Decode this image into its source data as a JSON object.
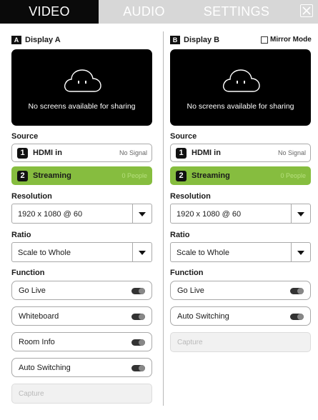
{
  "tabs": [
    {
      "label": "VIDEO",
      "active": true
    },
    {
      "label": "AUDIO",
      "active": false
    },
    {
      "label": "SETTINGS",
      "active": false
    }
  ],
  "close_icon": "close-x-icon",
  "display_a": {
    "letter": "A",
    "title": "Display A",
    "preview_message": "No screens available for sharing",
    "source_label": "Source",
    "sources": [
      {
        "num": "1",
        "name": "HDMI in",
        "status": "No Signal"
      },
      {
        "num": "2",
        "name": "Streaming",
        "status": "0 People"
      }
    ],
    "resolution_label": "Resolution",
    "resolution_value": "1920 x 1080 @ 60",
    "ratio_label": "Ratio",
    "ratio_value": "Scale to Whole",
    "function_label": "Function",
    "functions": [
      "Go Live",
      "Whiteboard",
      "Room Info",
      "Auto Switching"
    ],
    "capture_label": "Capture"
  },
  "display_b": {
    "letter": "B",
    "title": "Display B",
    "mirror_label": "Mirror Mode",
    "preview_message": "No screens available for sharing",
    "source_label": "Source",
    "sources": [
      {
        "num": "1",
        "name": "HDMI in",
        "status": "No Signal"
      },
      {
        "num": "2",
        "name": "Streaming",
        "status": "0 People"
      }
    ],
    "resolution_label": "Resolution",
    "resolution_value": "1920 x 1080 @ 60",
    "ratio_label": "Ratio",
    "ratio_value": "Scale to Whole",
    "function_label": "Function",
    "functions": [
      "Go Live",
      "Auto Switching"
    ],
    "capture_label": "Capture"
  },
  "colors": {
    "tab_active": "#0a0a0a",
    "tab_inactive": "#d7d7d7",
    "streaming_green": "#86bd3f"
  }
}
